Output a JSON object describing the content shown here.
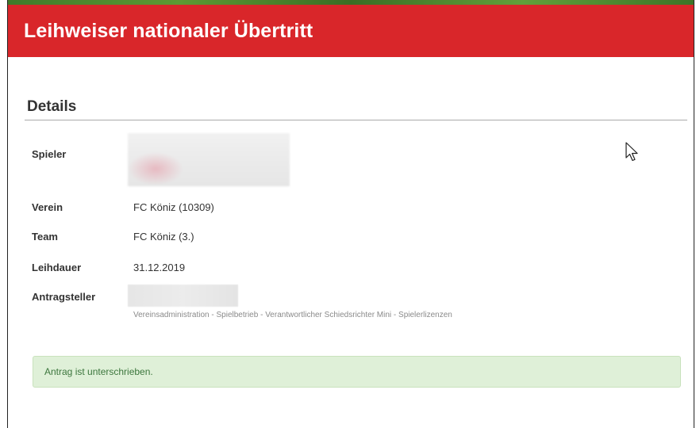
{
  "header": {
    "title": "Leihweiser nationaler Übertritt",
    "accent_color": "#d9262a"
  },
  "details": {
    "section_title": "Details",
    "rows": [
      {
        "label": "Spieler",
        "value": ""
      },
      {
        "label": "Verein",
        "value": "FC Köniz (10309)"
      },
      {
        "label": "Team",
        "value": "FC Köniz (3.)"
      },
      {
        "label": "Leihdauer",
        "value": "31.12.2019"
      },
      {
        "label": "Antragsteller",
        "value": ""
      }
    ],
    "applicant_roles": "Vereinsadministration - Spielbetrieb - Verantwortlicher Schiedsrichter Mini - Spielerlizenzen"
  },
  "status": {
    "message": "Antrag ist unterschrieben.",
    "color": "#3c763d"
  },
  "icons": {
    "cursor": "mouse-pointer-icon"
  }
}
